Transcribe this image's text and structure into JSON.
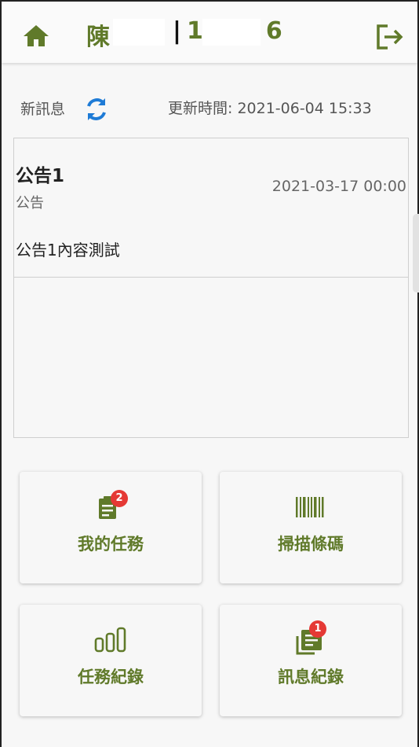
{
  "header": {
    "user_name": "陳",
    "separator": "|",
    "user_id_prefix": "1",
    "user_id_suffix": "6"
  },
  "news": {
    "label": "新訊息",
    "update_label": "更新時間: 2021-06-04 15:33"
  },
  "announcement": {
    "title": "公告1",
    "category": "公告",
    "date": "2021-03-17 00:00",
    "content": "公告1內容測試"
  },
  "tiles": {
    "my_tasks": {
      "label": "我的任務",
      "badge": "2"
    },
    "scan_barcode": {
      "label": "掃描條碼"
    },
    "task_records": {
      "label": "任務紀錄"
    },
    "message_records": {
      "label": "訊息紀錄",
      "badge": "1"
    }
  },
  "colors": {
    "brand_green": "#607a2a",
    "refresh_blue": "#1e7bd6",
    "badge_red": "#e53935"
  }
}
